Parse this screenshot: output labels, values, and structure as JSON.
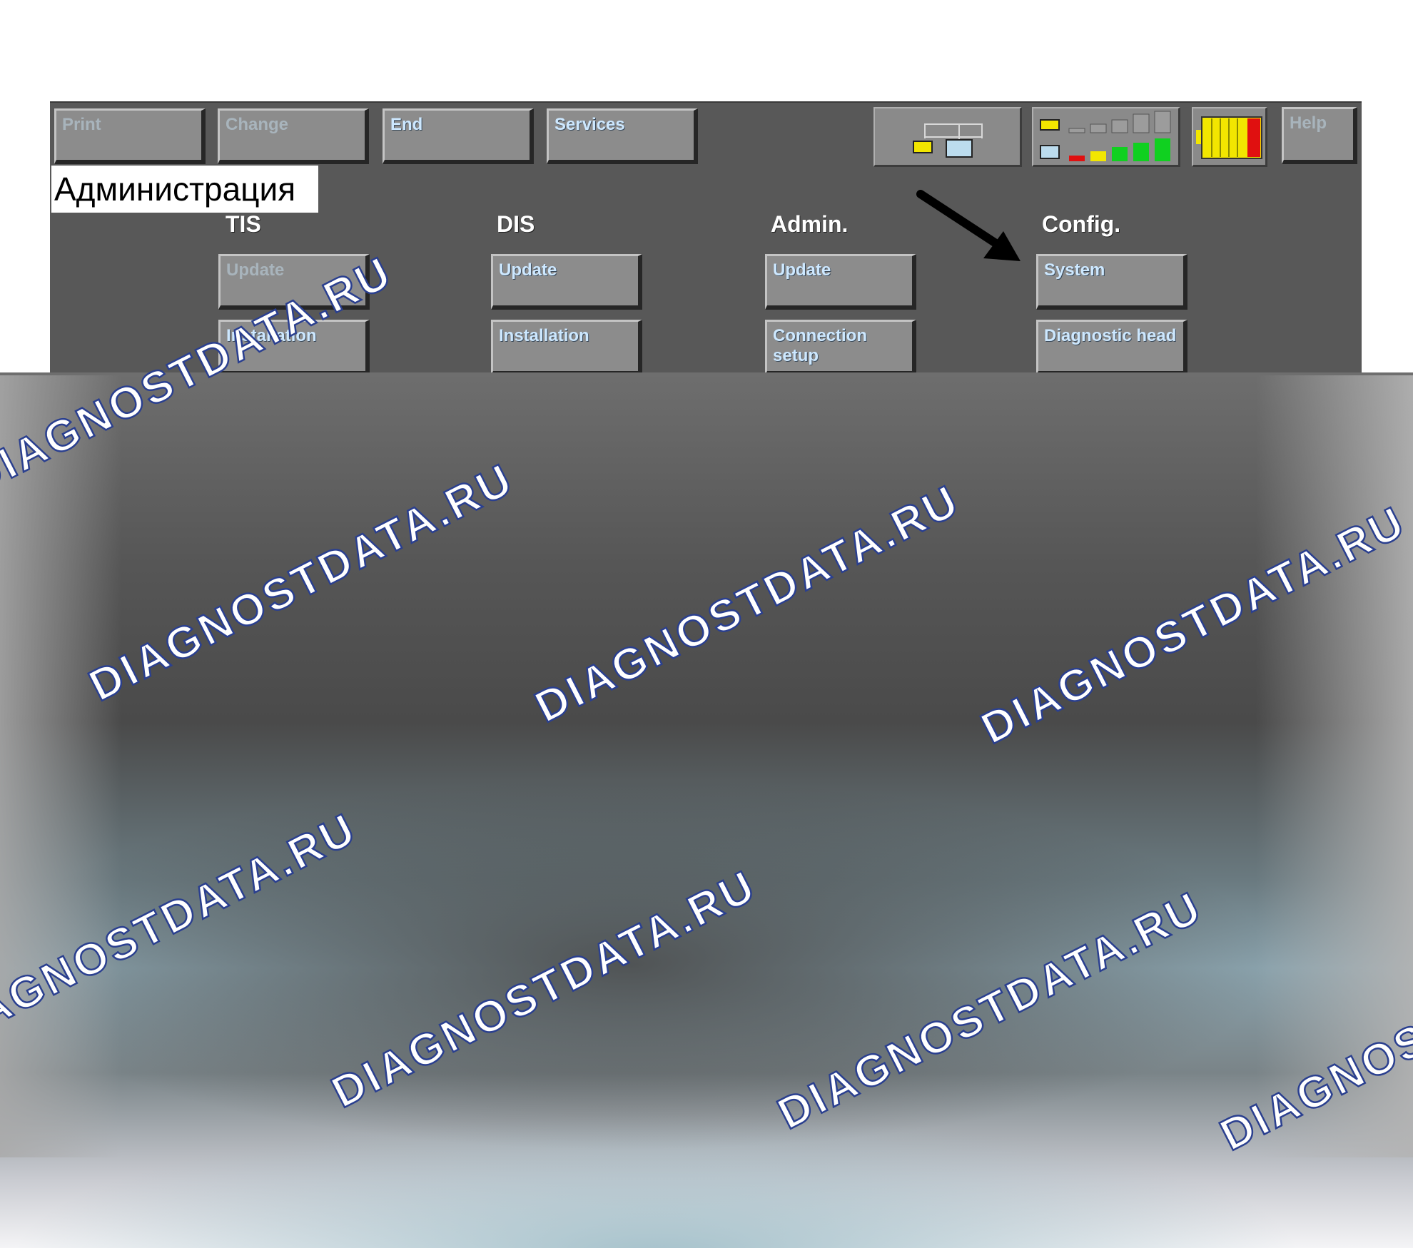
{
  "toolbar": {
    "print": "Print",
    "change": "Change",
    "end": "End",
    "services": "Services",
    "help": "Help"
  },
  "section_tag": "Администрация",
  "columns": [
    {
      "title": "TIS",
      "buttons": [
        "Update",
        "Installation"
      ]
    },
    {
      "title": "DIS",
      "buttons": [
        "Update",
        "Installation"
      ]
    },
    {
      "title": "Admin.",
      "buttons": [
        "Update",
        "Connection setup"
      ]
    },
    {
      "title": "Config.",
      "buttons": [
        "System",
        "Diagnostic head"
      ]
    }
  ],
  "indicators": [
    "connection-icon",
    "signal-strength-icon",
    "battery-icon"
  ],
  "colors": {
    "panel": "#585858",
    "button": "#8c8c8c",
    "button_text": "#cde8ff",
    "signal_red": "#e01010",
    "signal_yellow": "#f2e600",
    "signal_green": "#10d020",
    "watermark_outline": "#2a3f8f"
  },
  "watermark": "DIAGNOSTDATA.RU"
}
